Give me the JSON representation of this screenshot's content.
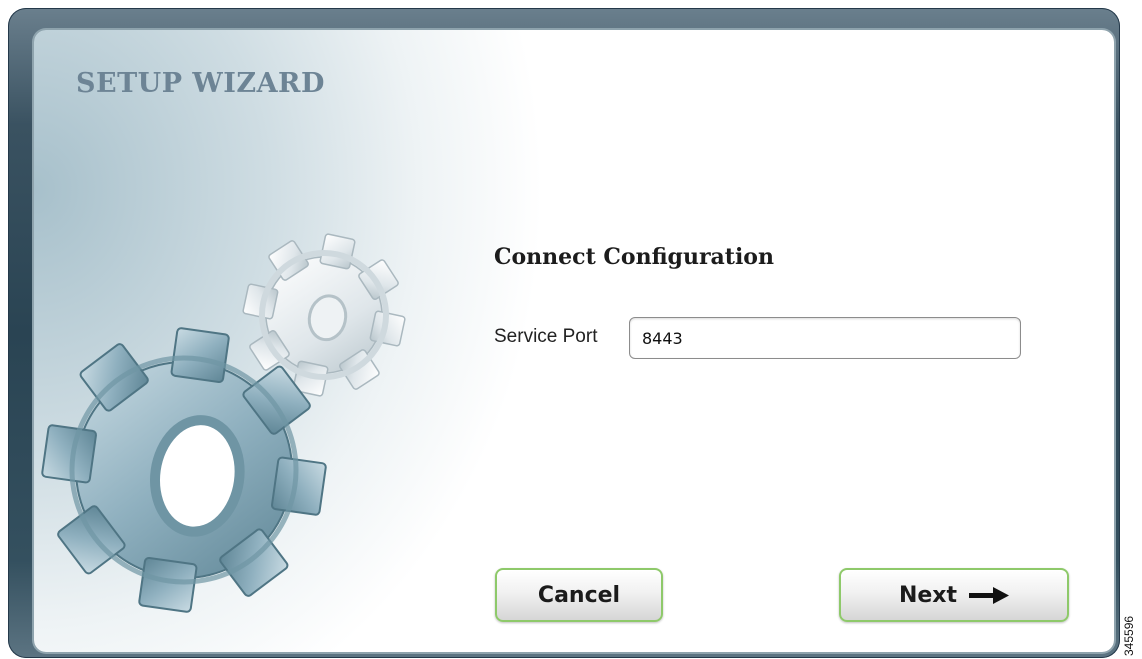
{
  "wizard": {
    "title": "SETUP WIZARD",
    "section_title": "Connect Configuration",
    "service_port": {
      "label": "Service Port",
      "value": "8443"
    },
    "buttons": {
      "cancel": "Cancel",
      "next": "Next"
    },
    "figure_id": "345596",
    "icons": {
      "decoration": "gears-icon",
      "next": "arrow-right-icon"
    },
    "colors": {
      "button_border": "#8ec96a",
      "title": "#6d8495"
    }
  }
}
